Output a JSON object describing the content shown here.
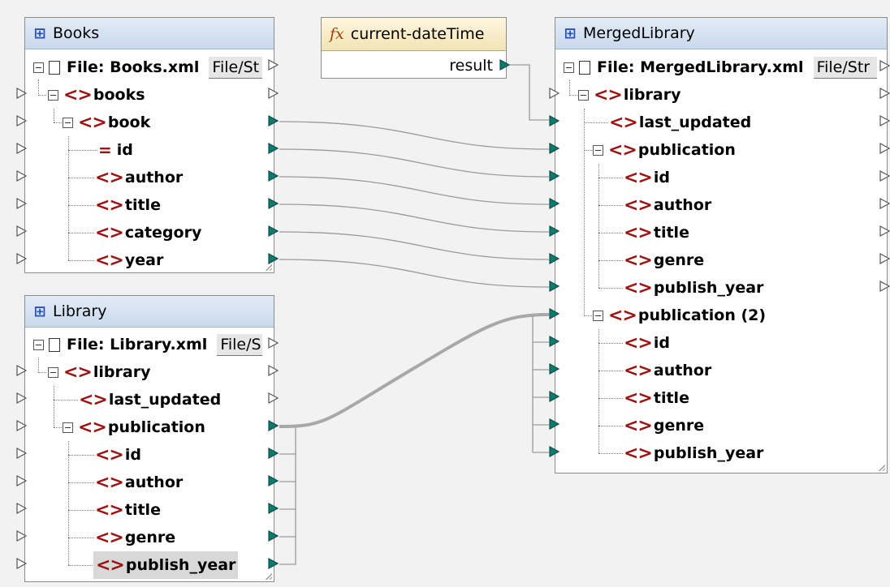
{
  "books": {
    "title": "Books",
    "file_label": "File: Books.xml",
    "file_button": "File/St",
    "items": {
      "books": "books",
      "book": "book",
      "id": "id",
      "author": "author",
      "title": "title",
      "category": "category",
      "year": "year"
    }
  },
  "library": {
    "title": "Library",
    "file_label": "File: Library.xml",
    "file_button": "File/S",
    "items": {
      "library": "library",
      "last_updated": "last_updated",
      "publication": "publication",
      "id": "id",
      "author": "author",
      "title": "title",
      "genre": "genre",
      "publish_year": "publish_year"
    }
  },
  "function": {
    "title": "current-dateTime",
    "output": "result",
    "icon": "fx"
  },
  "merged": {
    "title": "MergedLibrary",
    "file_label": "File: MergedLibrary.xml",
    "file_button": "File/Str",
    "items": {
      "library": "library",
      "last_updated": "last_updated",
      "publication": "publication",
      "p1_id": "id",
      "p1_author": "author",
      "p1_title": "title",
      "p1_genre": "genre",
      "p1_publish_year": "publish_year",
      "publication2": "publication (2)",
      "p2_id": "id",
      "p2_author": "author",
      "p2_title": "title",
      "p2_genre": "genre",
      "p2_publish_year": "publish_year"
    }
  },
  "icons": {
    "component": "component-tree-icon",
    "element": "xml-element-icon",
    "attribute": "xml-attribute-icon",
    "file": "file-icon",
    "collapse": "collapse-icon",
    "connector": "connector-icon"
  },
  "colors": {
    "connector_fill": "#0e7a6e",
    "element_icon": "#9b1414",
    "wire": "#9a9a9a",
    "header_blue": "#c9d9ec",
    "header_yellow": "#f2e2b5"
  }
}
